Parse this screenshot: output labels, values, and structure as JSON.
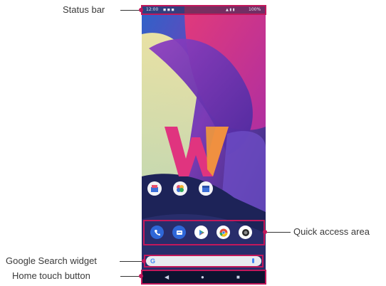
{
  "callouts": {
    "status_bar": "Status bar",
    "quick_access": "Quick access area",
    "google_search": "Google Search widget",
    "home_touch": "Home touch button"
  },
  "phone": {
    "status_bar": {
      "time": "12:00",
      "battery": "100%"
    },
    "home_apps": [
      {
        "icon": "store-icon",
        "color": "#f3f3f7"
      },
      {
        "icon": "photos-icon",
        "color": "#f3f3f7"
      },
      {
        "icon": "calendar-icon",
        "color": "#f3f3f7"
      }
    ],
    "dock": [
      {
        "icon": "phone-icon",
        "color": "#2f67d8"
      },
      {
        "icon": "messages-icon",
        "color": "#2f67d8"
      },
      {
        "icon": "play-store-icon",
        "color": "#ffffff"
      },
      {
        "icon": "chrome-icon",
        "color": "#ffffff"
      },
      {
        "icon": "camera-icon",
        "color": "#ffffff"
      }
    ],
    "search": {
      "google_letter": "G",
      "mic": "mic-icon"
    },
    "nav": {
      "back": "◀",
      "home": "●",
      "recents": "■"
    }
  },
  "colors": {
    "highlight": "#c2185b"
  }
}
